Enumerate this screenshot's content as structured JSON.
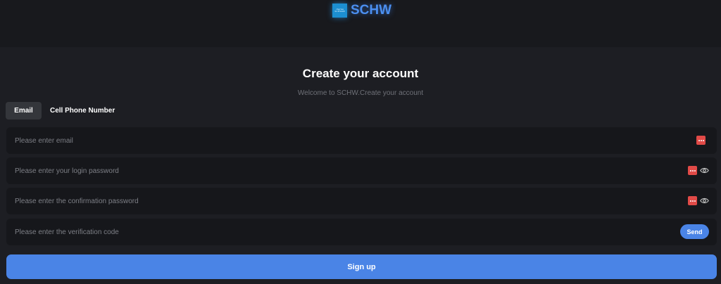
{
  "brand": {
    "logo_mark_line1": "charles",
    "logo_mark_line2": "SCHWAB",
    "name": "SCHW",
    "accent_color": "#4a84e6"
  },
  "page": {
    "title": "Create your account",
    "subtitle": "Welcome to  SCHW.Create your account"
  },
  "tabs": [
    {
      "label": "Email",
      "active": true
    },
    {
      "label": "Cell Phone Number",
      "active": false
    }
  ],
  "form": {
    "email": {
      "value": "",
      "placeholder": "Please enter email",
      "icons": [
        "password-manager-icon"
      ]
    },
    "password": {
      "value": "",
      "placeholder": "Please enter your login password",
      "icons": [
        "password-manager-icon",
        "eye-icon"
      ]
    },
    "confirm_password": {
      "value": "",
      "placeholder": "Please enter the confirmation password",
      "icons": [
        "password-manager-icon",
        "eye-icon"
      ]
    },
    "verification_code": {
      "value": "",
      "placeholder": "Please enter the verification code",
      "send_label": "Send"
    }
  },
  "signup_label": "Sign up"
}
